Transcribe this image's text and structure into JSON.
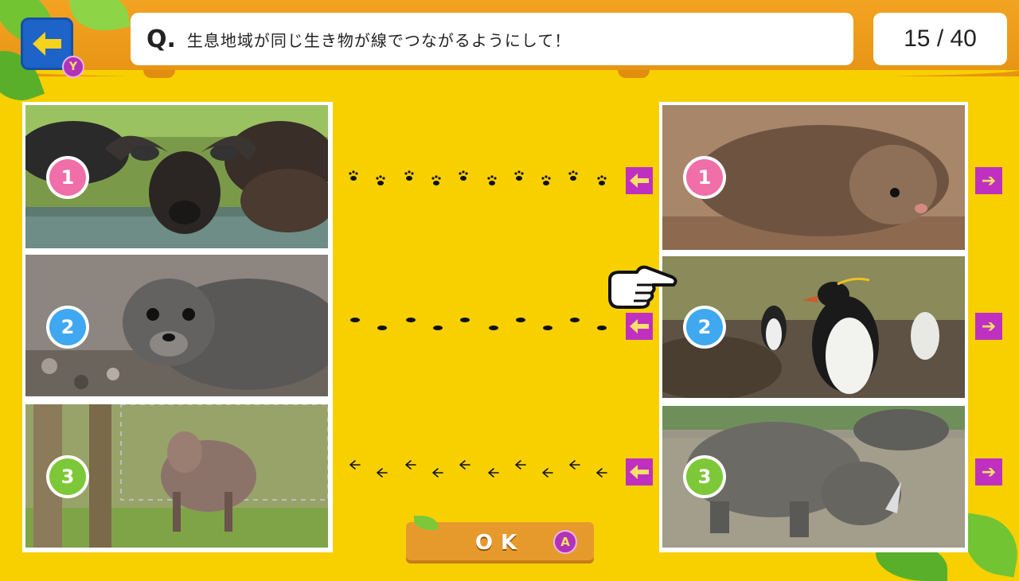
{
  "header": {
    "question_mark": "Q.",
    "question_text": "生息地域が同じ生き物が線でつながるようにして！",
    "counter": "15 / 40",
    "back_badge": "Y"
  },
  "left_items": [
    {
      "number": "1",
      "badge_color": "#f06fa8",
      "animal": "African buffalo"
    },
    {
      "number": "2",
      "badge_color": "#3fa8f0",
      "animal": "Fur seal"
    },
    {
      "number": "3",
      "badge_color": "#7cc838",
      "animal": "Japanese serow"
    }
  ],
  "right_items": [
    {
      "number": "1",
      "badge_color": "#f06fa8",
      "animal": "Flying squirrel"
    },
    {
      "number": "2",
      "badge_color": "#3fa8f0",
      "animal": "Rockhopper penguins"
    },
    {
      "number": "3",
      "badge_color": "#7cc838",
      "animal": "White rhinoceros"
    }
  ],
  "connectors": [
    {
      "row": 1,
      "style": "paw-prints"
    },
    {
      "row": 2,
      "style": "hoof-prints"
    },
    {
      "row": 3,
      "style": "bird-tracks"
    }
  ],
  "ok_button": {
    "label": "OK",
    "badge": "A"
  },
  "colors": {
    "background": "#f8d000",
    "header_wood": "#f3a322",
    "arrow_button": "#c030c0",
    "back_button": "#1e63c8"
  }
}
